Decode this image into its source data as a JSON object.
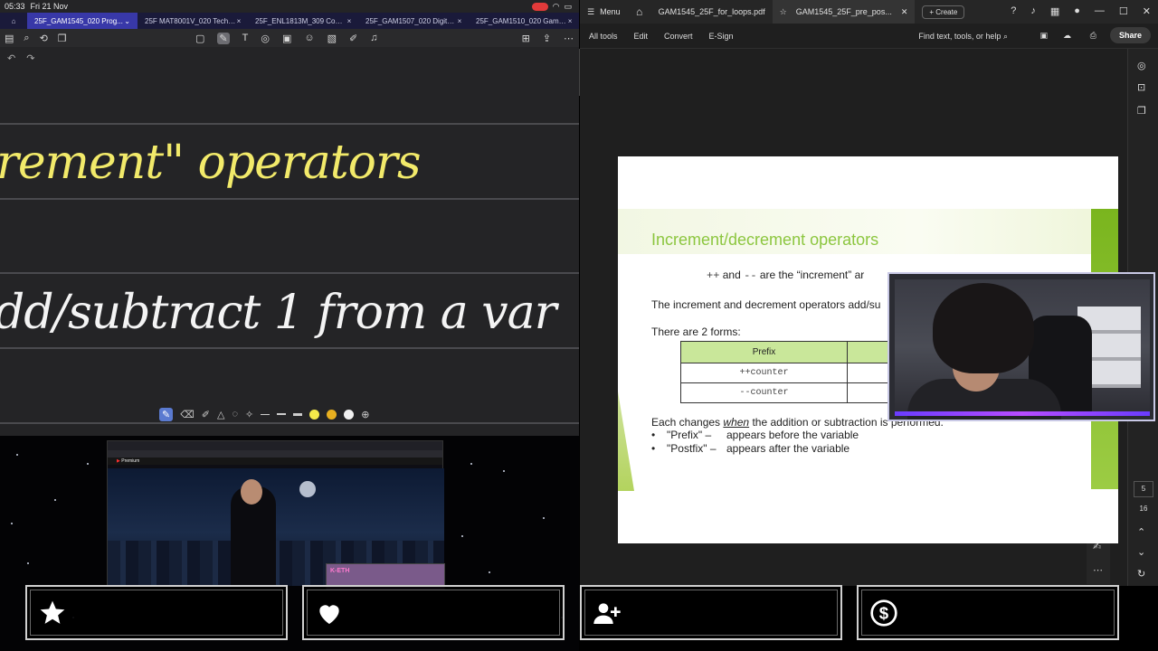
{
  "status_bar": {
    "time": "05:33",
    "date": "Fri 21 Nov"
  },
  "notes_tabs": [
    {
      "label": "25F_GAM1545_020 Prog...",
      "active": true
    },
    {
      "label": "25F MAT8001V_020 Tech M...",
      "active": false
    },
    {
      "label": "25F_ENL1813M_309 Comm...",
      "active": false
    },
    {
      "label": "25F_GAM1507_020 Digital I...",
      "active": false
    },
    {
      "label": "25F_GAM1510_020 Game D...",
      "active": false
    }
  ],
  "notes_content": {
    "line1": "rement\" operators",
    "line2": "dd/subtract 1 from a var"
  },
  "pen_colors": {
    "yellow": "#f5e94a",
    "gold": "#e8b020",
    "white": "#f0f0f0"
  },
  "acrobat": {
    "menu_label": "Menu",
    "tabs": [
      {
        "label": "GAM1545_25F_for_loops.pdf",
        "active": false
      },
      {
        "label": "GAM1545_25F_pre_pos...",
        "active": true
      }
    ],
    "create_label": "Create",
    "menu_items": [
      "All tools",
      "Edit",
      "Convert",
      "E-Sign"
    ],
    "find_label": "Find text, tools, or help",
    "share_label": "Share",
    "page_current": "5",
    "page_total": "16"
  },
  "slide": {
    "title": "Increment/decrement operators",
    "sub_op1": "++",
    "sub_and": "and",
    "sub_op2": "--",
    "sub_rest": "are the “increment” ar",
    "p1": "The increment and decrement operators add/su",
    "p2": "There are 2 forms:",
    "table_header": "Prefix",
    "table_rows": [
      "++counter",
      "--counter"
    ],
    "p3_pre": "Each changes",
    "p3_em": "when",
    "p3_post": "the addition or subtraction is performed.",
    "bullets": [
      {
        "term": "\"Prefix\" –",
        "desc": "appears before the variable"
      },
      {
        "term": "\"Postfix\" –",
        "desc": "appears after the variable"
      }
    ]
  },
  "youtube_overlay": {
    "logo": "Premium",
    "tag": "K-ETH"
  },
  "overlay_icons": [
    "star-icon",
    "heart-icon",
    "user-plus-icon",
    "dollar-icon"
  ]
}
